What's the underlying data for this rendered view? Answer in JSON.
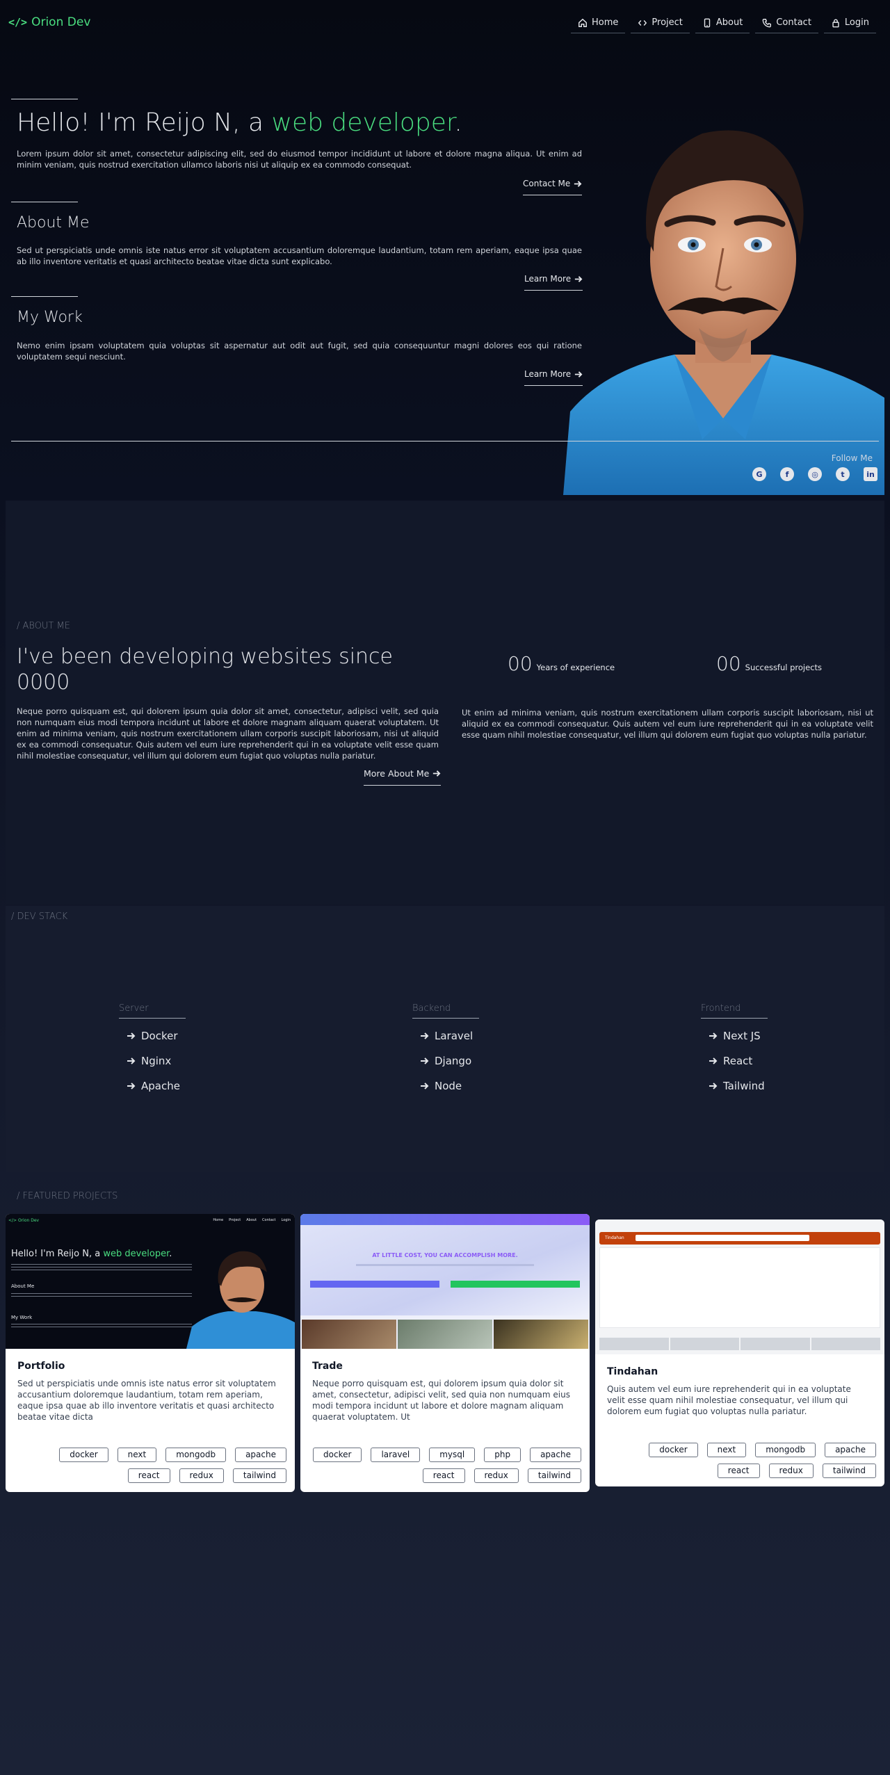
{
  "nav": {
    "brand_code": "</>",
    "brand_name": "Orion Dev",
    "items": [
      {
        "label": "Home",
        "icon": "home-icon"
      },
      {
        "label": "Project",
        "icon": "code-icon"
      },
      {
        "label": "About",
        "icon": "phone-device-icon"
      },
      {
        "label": "Contact",
        "icon": "phone-icon"
      },
      {
        "label": "Login",
        "icon": "lock-icon"
      }
    ]
  },
  "hero": {
    "greeting": "Hello! I'm Reijo N, a ",
    "role": "web developer",
    "period": ".",
    "intro": "Lorem ipsum dolor sit amet, consectetur adipiscing elit, sed do eiusmod tempor incididunt ut labore et dolore magna aliqua. Ut enim ad minim veniam, quis nostrud exercitation ullamco laboris nisi ut aliquip ex ea commodo consequat.",
    "contact_button": "Contact Me",
    "about_title": "About Me",
    "about_text": "Sed ut perspiciatis unde omnis iste natus error sit voluptatem accusantium doloremque laudantium, totam rem aperiam, eaque ipsa quae ab illo inventore veritatis et quasi architecto beatae vitae dicta sunt explicabo.",
    "about_button": "Learn More",
    "work_title": "My Work",
    "work_text": "Nemo enim ipsam voluptatem quia voluptas sit aspernatur aut odit aut fugit, sed quia consequuntur magni dolores eos qui ratione voluptatem sequi nesciunt.",
    "work_button": "Learn More",
    "follow_label": "Follow Me",
    "socials": [
      "google-icon",
      "facebook-icon",
      "instagram-icon",
      "twitter-icon",
      "linkedin-icon"
    ],
    "accent_color": "#4ade80"
  },
  "about": {
    "tag": "/ ABOUT ME",
    "heading": "I've been developing websites since 0000",
    "text": "Neque porro quisquam est, qui dolorem ipsum quia dolor sit amet, consectetur, adipisci velit, sed quia non numquam eius modi tempora incidunt ut labore et dolore magnam aliquam quaerat voluptatem. Ut enim ad minima veniam, quis nostrum exercitationem ullam corporis suscipit laboriosam, nisi ut aliquid ex ea commodi consequatur. Quis autem vel eum iure reprehenderit qui in ea voluptate velit esse quam nihil molestiae consequatur, vel illum qui dolorem eum fugiat quo voluptas nulla pariatur.",
    "button": "More About Me",
    "stats": [
      {
        "value": "00",
        "label": "Years of experience"
      },
      {
        "value": "00",
        "label": "Successful projects"
      }
    ],
    "side_text": "Ut enim ad minima veniam, quis nostrum exercitationem ullam corporis suscipit laboriosam, nisi ut aliquid ex ea commodi consequatur. Quis autem vel eum iure reprehenderit qui in ea voluptate velit esse quam nihil molestiae consequatur, vel illum qui dolorem eum fugiat quo voluptas nulla pariatur."
  },
  "stack": {
    "tag": "/ DEV STACK",
    "columns": [
      {
        "title": "Server",
        "items": [
          "Docker",
          "Nginx",
          "Apache"
        ]
      },
      {
        "title": "Backend",
        "items": [
          "Laravel",
          "Django",
          "Node"
        ]
      },
      {
        "title": "Frontend",
        "items": [
          "Next JS",
          "React",
          "Tailwind"
        ]
      }
    ]
  },
  "projects": {
    "tag": "/ FEATURED PROJECTS",
    "cards": [
      {
        "title": "Portfolio",
        "description": "Sed ut perspiciatis unde omnis iste natus error sit voluptatem accusantium doloremque laudantium, totam rem aperiam, eaque ipsa quae ab illo inventore veritatis et quasi architecto beatae vitae dicta",
        "tags": [
          "docker",
          "next",
          "mongodb",
          "apache",
          "react",
          "redux",
          "tailwind"
        ],
        "thumb": {
          "brand": "</> Orion Dev",
          "nav": [
            "Home",
            "Project",
            "About",
            "Contact",
            "Login"
          ],
          "greeting": "Hello! I'm Reijo N, a ",
          "role": "web developer",
          "about": "About Me",
          "work": "My Work"
        }
      },
      {
        "title": "Trade",
        "description": "Neque porro quisquam est, qui dolorem ipsum quia dolor sit amet, consectetur, adipisci velit, sed quia non numquam eius modi tempora incidunt ut labore et dolore magnam aliquam quaerat voluptatem. Ut",
        "tags": [
          "docker",
          "laravel",
          "mysql",
          "php",
          "apache",
          "react",
          "redux",
          "tailwind"
        ],
        "thumb": {
          "headline": "AT LITTLE COST, YOU CAN ACCOMPLISH MORE."
        }
      },
      {
        "title": "Tindahan",
        "description": "Quis autem vel eum iure reprehenderit qui in ea voluptate velit esse quam nihil molestiae consequatur, vel illum qui dolorem eum fugiat quo voluptas nulla pariatur.",
        "tags": [
          "docker",
          "next",
          "mongodb",
          "apache",
          "react",
          "redux",
          "tailwind"
        ],
        "thumb": {
          "brand": "Tindahan"
        }
      }
    ]
  }
}
